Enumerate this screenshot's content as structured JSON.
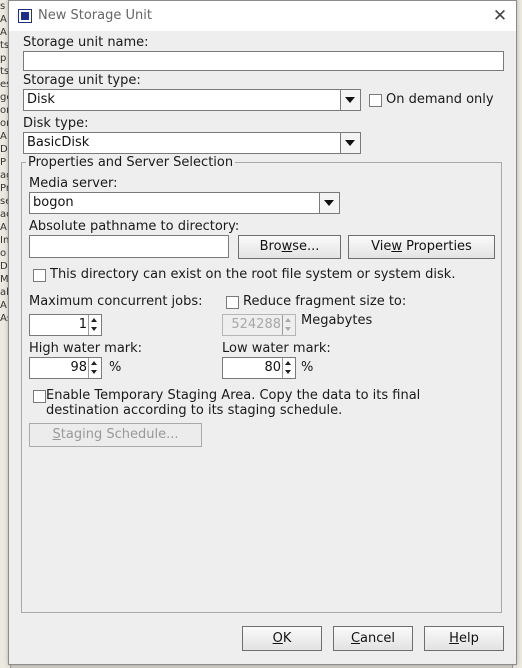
{
  "dialog": {
    "title": "New Storage Unit"
  },
  "form": {
    "storage_unit_name_label": "Storage unit name:",
    "storage_unit_name_value": "",
    "storage_unit_type_label": "Storage unit type:",
    "storage_unit_type_value": "Disk",
    "on_demand_label": "On demand only",
    "disk_type_label": "Disk type:",
    "disk_type_value": "BasicDisk"
  },
  "properties": {
    "group_title": "Properties and Server Selection",
    "media_server_label": "Media server:",
    "media_server_value": "bogon",
    "path_label": "Absolute pathname to directory:",
    "path_value": "",
    "browse_label_pre": "Bro",
    "browse_label_mnemonic": "w",
    "browse_label_post": "se...",
    "view_props_pre": "Vie",
    "view_props_mnemonic": "w",
    "view_props_post": " Properties",
    "root_fs_label": "This directory can exist on the root file system or system disk.",
    "max_jobs_label": "Maximum concurrent jobs:",
    "max_jobs_value": "1",
    "reduce_fragment_label": "Reduce fragment size to:",
    "fragment_value": "524288",
    "fragment_unit": "Megabytes",
    "high_water_label": "High water mark:",
    "high_water_value": "98",
    "high_water_unit": "%",
    "low_water_label": "Low water mark:",
    "low_water_value": "80",
    "low_water_unit": "%",
    "staging_label_line1": "Enable Temporary Staging Area.  Copy the data to its final",
    "staging_label_line2": "destination according to its staging schedule.",
    "staging_schedule_mnemonic": "S",
    "staging_schedule_rest": "taging Schedule..."
  },
  "footer": {
    "ok_mnemonic": "O",
    "ok_rest": "K",
    "cancel_mnemonic": "C",
    "cancel_rest": "ancel",
    "help_mnemonic": "H",
    "help_rest": "elp"
  },
  "background": {
    "strip_letters": [
      "s",
      "A",
      "A",
      "ts",
      "p",
      "ts",
      "es",
      "ge",
      "or",
      "or",
      "A",
      "D",
      "P",
      "ag",
      "Pr",
      "se",
      "ac",
      "A",
      "In",
      "o",
      "D",
      "M",
      "al",
      "A",
      "As"
    ]
  },
  "colors": {
    "dialog_bg": "#eeeeee",
    "title_icon": "#1c2f8c"
  }
}
